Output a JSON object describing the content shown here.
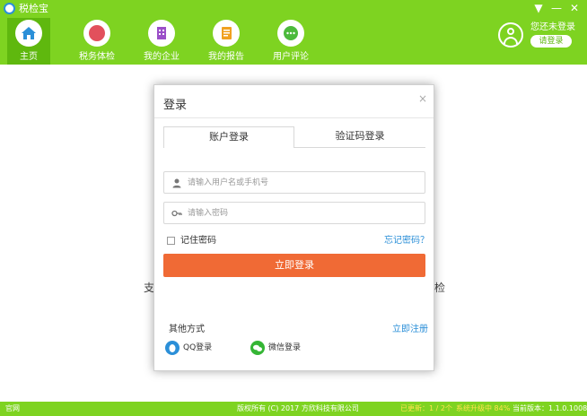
{
  "app": {
    "title": "税检宝"
  },
  "window_controls": {
    "menu": "▼",
    "minimize": "—",
    "close": "✕"
  },
  "nav": [
    {
      "label": "主页",
      "icon": "home-icon",
      "color": "#2b8fd8"
    },
    {
      "label": "税务体检",
      "icon": "tax-check-icon",
      "color": "#e2505c"
    },
    {
      "label": "我的企业",
      "icon": "enterprise-icon",
      "color": "#9b4fc8"
    },
    {
      "label": "我的报告",
      "icon": "report-icon",
      "color": "#f0a020"
    },
    {
      "label": "用户评论",
      "icon": "comment-icon",
      "color": "#4cba3c"
    }
  ],
  "user": {
    "status": "您还未登录",
    "login_button": "请登录"
  },
  "background": {
    "left_text": "支",
    "right_text": "检"
  },
  "modal": {
    "title": "登录",
    "close": "×",
    "tabs": [
      {
        "label": "账户登录"
      },
      {
        "label": "验证码登录"
      }
    ],
    "username_placeholder": "请输入用户名或手机号",
    "password_placeholder": "请输入密码",
    "remember_label": "记住密码",
    "forgot_link": "忘记密码？",
    "submit_label": "立即登录",
    "other_label": "其他方式",
    "register_link": "立即注册",
    "social": [
      {
        "label": "QQ登录",
        "icon": "qq-icon",
        "color": "#2b8fd8"
      },
      {
        "label": "微信登录",
        "icon": "wechat-icon",
        "color": "#35b535"
      }
    ]
  },
  "status_bar": {
    "left": "官网",
    "center": "版权所有 (C) 2017 方欣科技有限公司",
    "updated": "已更新：1 / 2个",
    "upgrading": "系统升级中 84%",
    "version": "当前版本：1.1.0.1008"
  },
  "colors": {
    "brand_green": "#7ed321",
    "submit_orange": "#f06a35",
    "link_blue": "#2b8fd8"
  }
}
